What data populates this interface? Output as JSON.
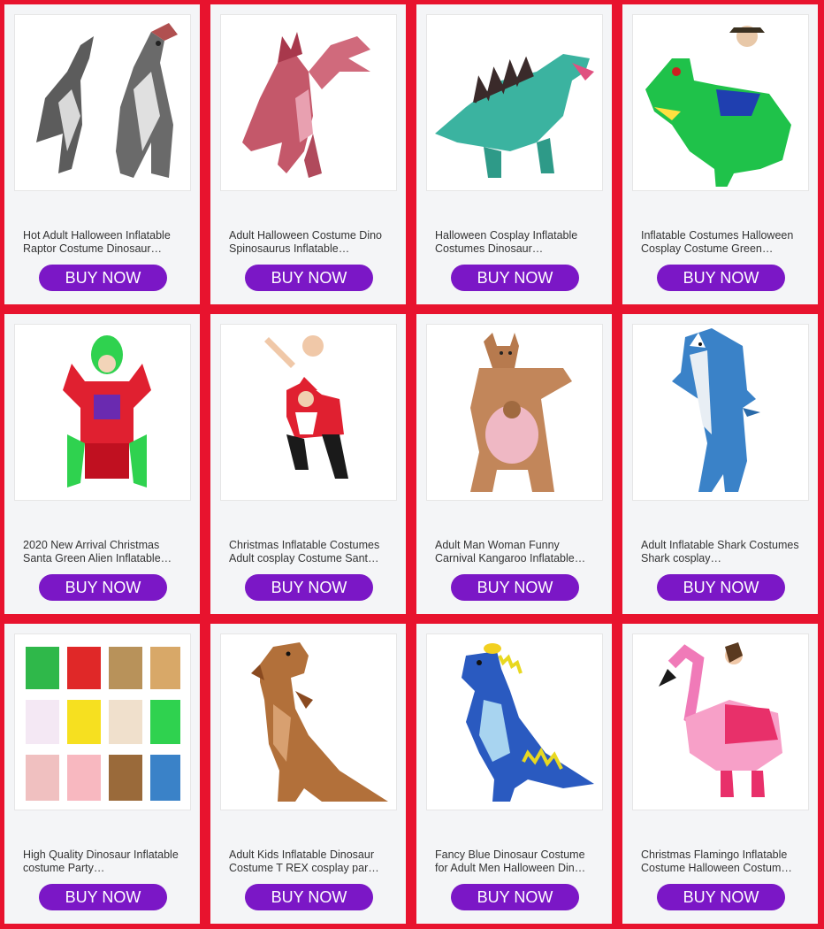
{
  "colors": {
    "background": "#e8132e",
    "card": "#f4f5f7",
    "button": "#7b17c6"
  },
  "products": [
    {
      "title": "Hot Adult Halloween Inflatable Raptor Costume Dinosaur…",
      "button": "BUY NOW",
      "image": "gray-raptor-costume"
    },
    {
      "title": "Adult Halloween Costume Dino Spinosaurus Inflatable…",
      "button": "BUY NOW",
      "image": "pink-spinosaurus-costume"
    },
    {
      "title": "Halloween Cosplay Inflatable Costumes Dinosaur…",
      "button": "BUY NOW",
      "image": "green-stegosaurus-costume"
    },
    {
      "title": "Inflatable Costumes Halloween Cosplay Costume Green…",
      "button": "BUY NOW",
      "image": "green-dino-rider-costume"
    },
    {
      "title": "2020 New Arrival Christmas Santa Green Alien Inflatable…",
      "button": "BUY NOW",
      "image": "alien-santa-costume"
    },
    {
      "title": "Christmas Inflatable Costumes Adult cosplay Costume Sant…",
      "button": "BUY NOW",
      "image": "santa-rider-costume"
    },
    {
      "title": "Adult Man Woman Funny Carnival Kangaroo Inflatable…",
      "button": "BUY NOW",
      "image": "kangaroo-costume"
    },
    {
      "title": "Adult Inflatable Shark Costumes Shark cosplay…",
      "button": "BUY NOW",
      "image": "blue-shark-costume"
    },
    {
      "title": "High Quality Dinosaur Inflatable costume Party…",
      "button": "BUY NOW",
      "image": "costume-collage"
    },
    {
      "title": "Adult Kids Inflatable Dinosaur Costume T REX cosplay par…",
      "button": "BUY NOW",
      "image": "trex-costume"
    },
    {
      "title": "Fancy Blue Dinosaur Costume for Adult Men Halloween Din…",
      "button": "BUY NOW",
      "image": "blue-dinosaur-costume"
    },
    {
      "title": "Christmas Flamingo Inflatable Costume Halloween Costum…",
      "button": "BUY NOW",
      "image": "flamingo-rider-costume"
    }
  ]
}
